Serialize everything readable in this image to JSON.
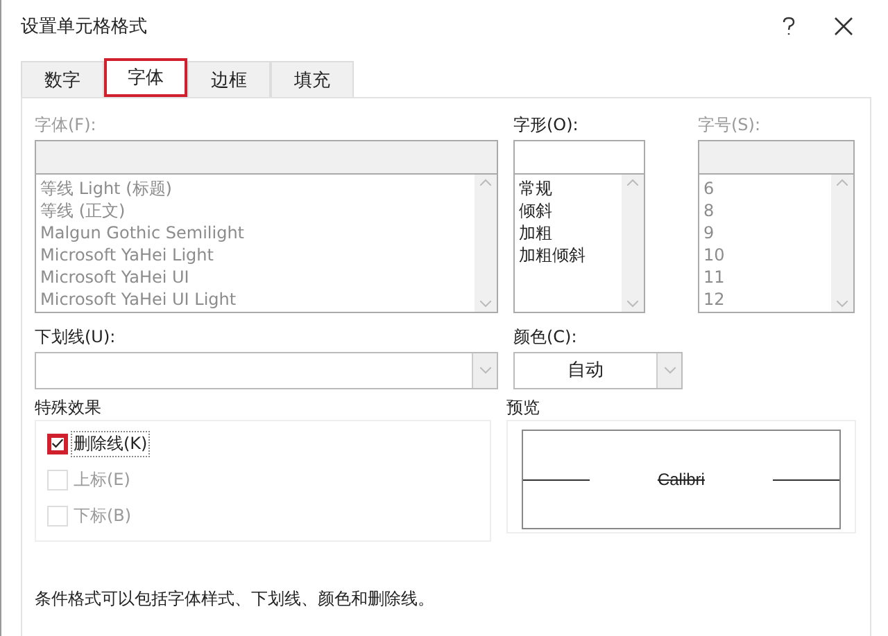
{
  "window": {
    "title": "设置单元格格式"
  },
  "tabs": [
    {
      "label": "数字",
      "selected": false,
      "highlighted": false
    },
    {
      "label": "字体",
      "selected": true,
      "highlighted": true
    },
    {
      "label": "边框",
      "selected": false,
      "highlighted": false
    },
    {
      "label": "填充",
      "selected": false,
      "highlighted": false
    }
  ],
  "font": {
    "label": "字体(F):",
    "disabled": true,
    "items": [
      "等线 Light (标题)",
      "等线 (正文)",
      "Malgun Gothic Semilight",
      "Microsoft YaHei Light",
      "Microsoft YaHei UI",
      "Microsoft YaHei UI Light"
    ]
  },
  "style": {
    "label": "字形(O):",
    "disabled": false,
    "items": [
      "常规",
      "倾斜",
      "加粗",
      "加粗倾斜"
    ]
  },
  "size": {
    "label": "字号(S):",
    "disabled": true,
    "items": [
      "6",
      "8",
      "9",
      "10",
      "11",
      "12"
    ]
  },
  "underline": {
    "label": "下划线(U):"
  },
  "color": {
    "label": "颜色(C):",
    "value": "自动"
  },
  "effects": {
    "title": "特殊效果",
    "items": [
      {
        "label": "删除线(K)",
        "checked": true,
        "disabled": false,
        "highlighted": true
      },
      {
        "label": "上标(E)",
        "checked": false,
        "disabled": true,
        "highlighted": false
      },
      {
        "label": "下标(B)",
        "checked": false,
        "disabled": true,
        "highlighted": false
      }
    ]
  },
  "preview": {
    "title": "预览",
    "sample": "Calibri",
    "strikethrough": true
  },
  "note": "条件格式可以包括字体样式、下划线、颜色和删除线。"
}
